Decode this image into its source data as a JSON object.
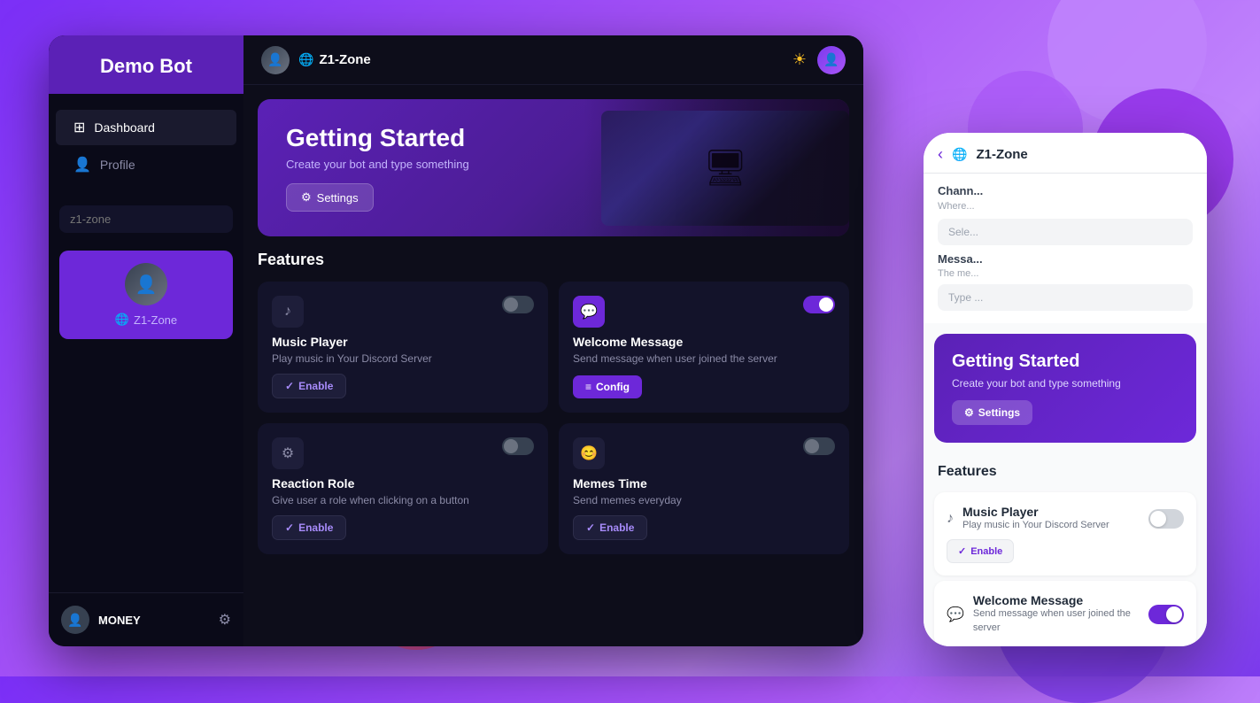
{
  "app": {
    "title": "Demo Bot",
    "theme": "dark"
  },
  "sidebar": {
    "logo": "Demo Bot",
    "nav_items": [
      {
        "id": "dashboard",
        "label": "Dashboard",
        "icon": "⊞",
        "active": true
      },
      {
        "id": "profile",
        "label": "Profile",
        "icon": "👤",
        "active": false
      }
    ],
    "search_placeholder": "z1-zone",
    "server_name": "Z1-Zone",
    "footer": {
      "username": "MONEY",
      "gear_label": "⚙"
    }
  },
  "topbar": {
    "server_name": "Z1-Zone",
    "globe_icon": "🌐"
  },
  "banner": {
    "title": "Getting Started",
    "subtitle": "Create your bot and type something",
    "settings_btn": "Settings"
  },
  "features": {
    "section_title": "Features",
    "cards": [
      {
        "id": "music-player",
        "title": "Music Player",
        "description": "Play music in Your Discord Server",
        "icon": "♪",
        "toggle": false,
        "enable_btn": "Enable",
        "config_btn": null
      },
      {
        "id": "welcome-message",
        "title": "Welcome Message",
        "description": "Send message when user joined the server",
        "icon": "💬",
        "toggle": true,
        "enable_btn": null,
        "config_btn": "Config"
      },
      {
        "id": "reaction-role",
        "title": "Reaction Role",
        "description": "Give user a role when clicking on a button",
        "icon": "⚙",
        "toggle": false,
        "enable_btn": "Enable",
        "config_btn": null
      },
      {
        "id": "memes-time",
        "title": "Memes Time",
        "description": "Send memes everyday",
        "icon": "😊",
        "toggle": false,
        "enable_btn": "Enable",
        "config_btn": null
      }
    ]
  },
  "mobile": {
    "server_name": "Z1-Zone",
    "banner": {
      "title": "Getting Started",
      "subtitle": "Create your bot and type something",
      "settings_btn": "Settings"
    },
    "features_label": "Features",
    "cards": [
      {
        "id": "music-player",
        "title": "Music Player",
        "description": "Play music in Your Discord Server",
        "icon": "♪",
        "toggle": false,
        "enable_btn": "Enable"
      },
      {
        "id": "welcome-message",
        "title": "Welcome Message",
        "description": "Send message when user joined the server",
        "icon": "💬",
        "toggle": true,
        "enable_btn": null
      }
    ]
  },
  "decorative": {
    "back_btn": "‹"
  }
}
